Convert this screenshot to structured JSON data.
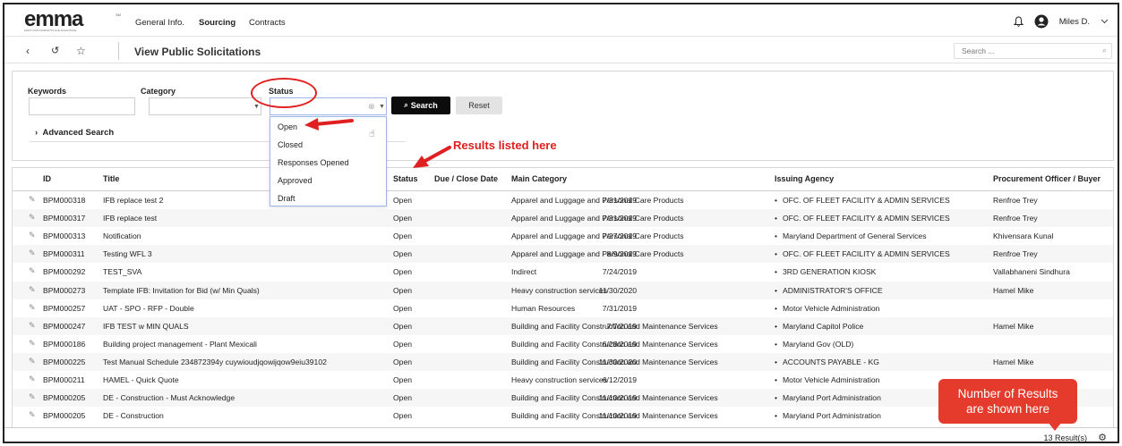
{
  "nav": {
    "logo_main": "emma",
    "logo_tag": "SM",
    "logo_sub": "MARYLAND MARKETPLACE ADVANTAGE",
    "items": [
      "General Info.",
      "Sourcing",
      "Contracts"
    ],
    "active": "Sourcing",
    "user": "Miles D."
  },
  "subbar": {
    "title": "View Public Solicitations",
    "search_placeholder": "Search ..."
  },
  "filters": {
    "keywords_label": "Keywords",
    "category_label": "Category",
    "status_label": "Status",
    "search_btn": "Search",
    "reset_btn": "Reset",
    "advanced": "Advanced Search"
  },
  "status_options": [
    "Open",
    "Closed",
    "Responses Opened",
    "Approved",
    "Draft"
  ],
  "table": {
    "headers": [
      "ID",
      "Title",
      "Status",
      "Due / Close Date",
      "Main Category",
      "Issuing Agency",
      "Procurement Officer / Buyer"
    ],
    "rows": [
      [
        "BPM000318",
        "IFB replace test 2",
        "Open",
        "7/31/2019",
        "Apparel and Luggage and Personal Care Products",
        "OFC. OF FLEET FACILITY & ADMIN SERVICES",
        "Renfroe Trey"
      ],
      [
        "BPM000317",
        "IFB replace test",
        "Open",
        "7/31/2019",
        "Apparel and Luggage and Personal Care Products",
        "OFC. OF FLEET FACILITY & ADMIN SERVICES",
        "Renfroe Trey"
      ],
      [
        "BPM000313",
        "Notification",
        "Open",
        "7/27/2019",
        "Apparel and Luggage and Personal Care Products",
        "Maryland Department of General Services",
        "Khivensara Kunal"
      ],
      [
        "BPM000311",
        "Testing WFL 3",
        "Open",
        "8/9/2019",
        "Apparel and Luggage and Personal Care Products",
        "OFC. OF FLEET FACILITY & ADMIN SERVICES",
        "Renfroe Trey"
      ],
      [
        "BPM000292",
        "TEST_SVA",
        "Open",
        "7/24/2019",
        "Indirect",
        "3RD GENERATION KIOSK",
        "Vallabhaneni Sindhura"
      ],
      [
        "BPM000273",
        "Template IFB: Invitation for Bid (w/ Min Quals)",
        "Open",
        "11/30/2020",
        "Heavy construction services",
        "ADMINISTRATOR'S OFFICE",
        "Hamel Mike"
      ],
      [
        "BPM000257",
        "UAT - SPO - RFP - Double",
        "Open",
        "7/31/2019",
        "Human Resources",
        "Motor Vehicle Administration",
        ""
      ],
      [
        "BPM000247",
        "IFB TEST w MIN QUALS",
        "Open",
        "7/7/2019",
        "Building and Facility Construction and Maintenance Services",
        "Maryland Capitol Police",
        "Hamel Mike"
      ],
      [
        "BPM000186",
        "Building project management - Plant Mexicali",
        "Open",
        "6/28/2019",
        "Building and Facility Construction and Maintenance Services",
        "Maryland Gov (OLD)",
        ""
      ],
      [
        "BPM000225",
        "Test Manual Schedule 234872394y cuywioudjqowijqow9eiu39102",
        "Open",
        "11/30/2020",
        "Building and Facility Construction and Maintenance Services",
        "ACCOUNTS PAYABLE - KG",
        "Hamel Mike"
      ],
      [
        "BPM000211",
        "HAMEL - Quick Quote",
        "Open",
        "6/12/2019",
        "Heavy construction services",
        "Motor Vehicle Administration",
        ""
      ],
      [
        "BPM000205",
        "DE - Construction - Must Acknowledge",
        "Open",
        "11/10/2019",
        "Building and Facility Construction and Maintenance Services",
        "Maryland Port Administration",
        ""
      ],
      [
        "BPM000205",
        "DE - Construction",
        "Open",
        "11/10/2019",
        "Building and Facility Construction and Maintenance Services",
        "Maryland Port Administration",
        ""
      ]
    ]
  },
  "footer": {
    "result_count": "13 Result(s)"
  },
  "annotations": {
    "results_text": "Results listed here",
    "callout_line1": "Number of Results",
    "callout_line2": "are shown here"
  },
  "colors": {
    "accent_red": "#e02020",
    "button_dark": "#0c0c0c",
    "logo_orange": "#f0a020"
  }
}
